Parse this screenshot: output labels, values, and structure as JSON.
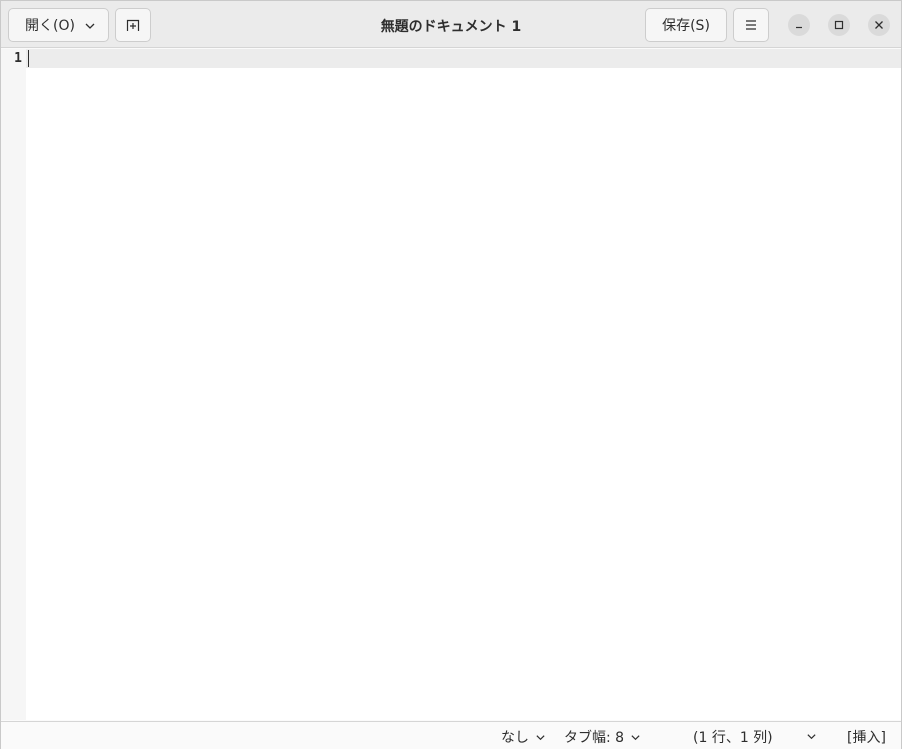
{
  "window": {
    "title": "無題のドキュメント 1"
  },
  "header": {
    "open_label": "開く(O)",
    "save_label": "保存(S)"
  },
  "editor": {
    "line_numbers": [
      "1"
    ],
    "content": ""
  },
  "statusbar": {
    "language": "なし",
    "tab_width": "タブ幅: 8",
    "position": "(1 行、1 列)",
    "mode": "[挿入]"
  },
  "icons": {
    "open_dropdown": "chevron-down-icon",
    "new_tab": "new-tab-icon",
    "menu": "hamburger-menu-icon",
    "minimize": "minimize-icon",
    "maximize": "maximize-icon",
    "close": "close-icon"
  },
  "colors": {
    "headerbar": "#ebebeb",
    "editor_bg": "#ffffff",
    "current_line": "#ececec",
    "gutter": "#f6f6f6"
  }
}
